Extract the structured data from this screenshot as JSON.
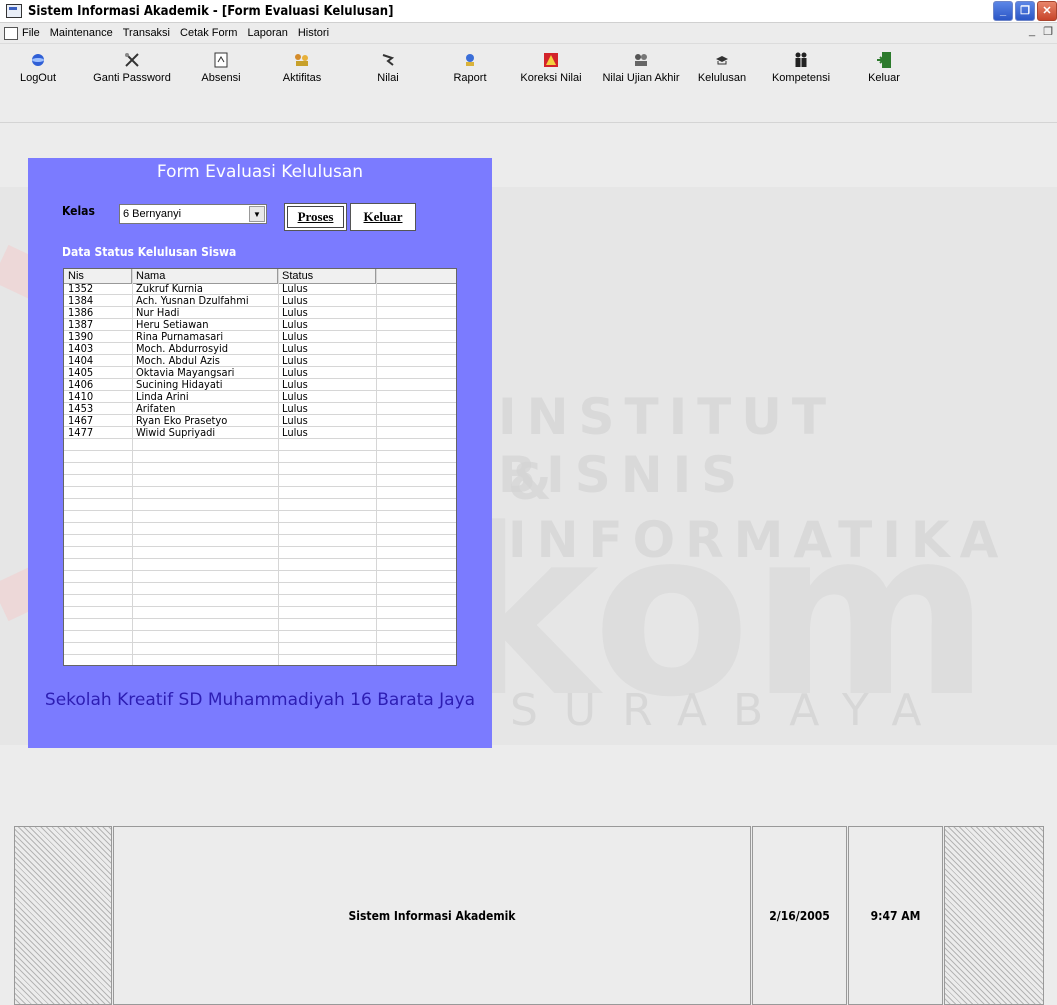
{
  "window": {
    "title": "Sistem Informasi Akademik - [Form Evaluasi Kelulusan]"
  },
  "menu": [
    "File",
    "Maintenance",
    "Transaksi",
    "Cetak Form",
    "Laporan",
    "Histori"
  ],
  "toolbar": [
    {
      "label": "LogOut",
      "icon": "globe-icon"
    },
    {
      "label": "Ganti Password",
      "icon": "tools-icon"
    },
    {
      "label": "Absensi",
      "icon": "document-icon"
    },
    {
      "label": "Aktifitas",
      "icon": "users-icon"
    },
    {
      "label": "Nilai",
      "icon": "hand-icon"
    },
    {
      "label": "Raport",
      "icon": "book-icon"
    },
    {
      "label": "Koreksi Nilai",
      "icon": "warning-icon"
    },
    {
      "label": "Nilai Ujian Akhir",
      "icon": "people-icon"
    },
    {
      "label": "Kelulusan",
      "icon": "graduation-icon"
    },
    {
      "label": "Kompetensi",
      "icon": "couple-icon"
    },
    {
      "label": "Keluar",
      "icon": "exit-door-icon"
    }
  ],
  "form": {
    "title": "Form Evaluasi Kelulusan",
    "kelas_label": "Kelas",
    "kelas_value": "6 Bernyanyi",
    "proses_button": "Proses",
    "keluar_button": "Keluar",
    "section_label": "Data Status Kelulusan Siswa",
    "columns": [
      "Nis",
      "Nama",
      "Status"
    ],
    "rows": [
      [
        "1352",
        "Zukruf Kurnia",
        "Lulus"
      ],
      [
        "1384",
        "Ach. Yusnan Dzulfahmi",
        "Lulus"
      ],
      [
        "1386",
        "Nur Hadi",
        "Lulus"
      ],
      [
        "1387",
        "Heru Setiawan",
        "Lulus"
      ],
      [
        "1390",
        "Rina Purnamasari",
        "Lulus"
      ],
      [
        "1403",
        "Moch. Abdurrosyid",
        "Lulus"
      ],
      [
        "1404",
        "Moch. Abdul Azis",
        "Lulus"
      ],
      [
        "1405",
        "Oktavia Mayangsari",
        "Lulus"
      ],
      [
        "1406",
        "Sucining Hidayati",
        "Lulus"
      ],
      [
        "1410",
        "Linda Arini",
        "Lulus"
      ],
      [
        "1453",
        "Arifaten",
        "Lulus"
      ],
      [
        "1467",
        "Ryan Eko Prasetyo",
        "Lulus"
      ],
      [
        "1477",
        "Wiwid Supriyadi",
        "Lulus"
      ]
    ],
    "footer": "Sekolah Kreatif SD Muhammadiyah 16 Barata Jaya"
  },
  "watermark": {
    "line1": "INSTITUT BISNIS",
    "line2": "& INFORMATIKA",
    "logo": "stikom",
    "city": "SURABAYA"
  },
  "status": {
    "app": "Sistem Informasi Akademik",
    "date": "2/16/2005",
    "time": "9:47 AM"
  },
  "colors": {
    "panel": "#7b7bff",
    "footer_text": "#2d1eb3"
  }
}
